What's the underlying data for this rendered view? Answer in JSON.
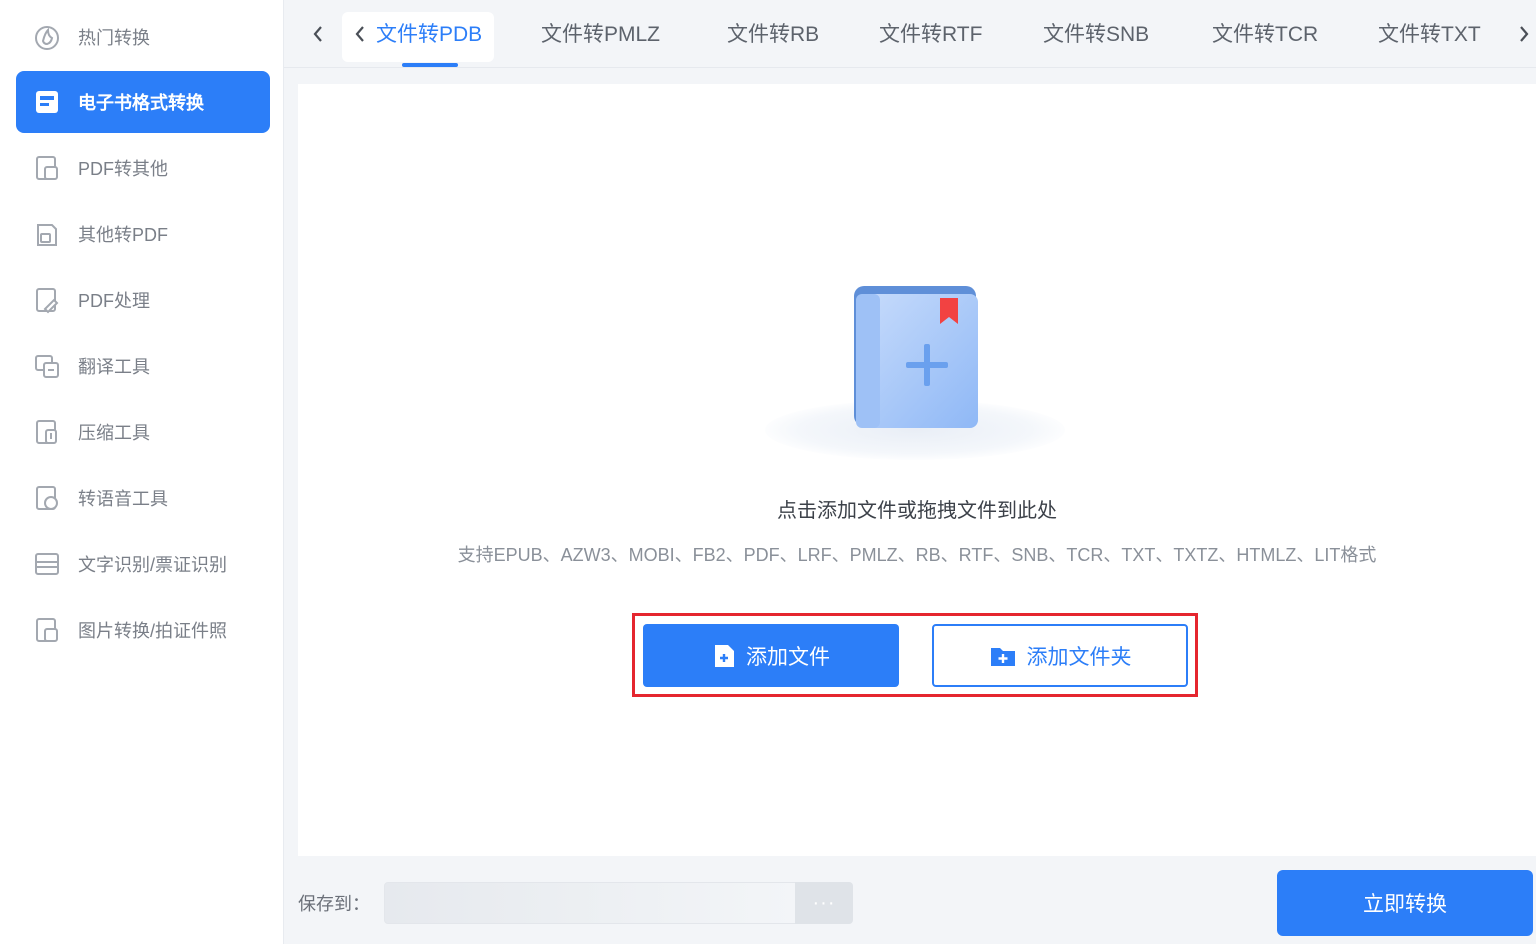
{
  "sidebar": {
    "items": [
      {
        "label": "热门转换",
        "icon": "hot-convert-icon"
      },
      {
        "label": "电子书格式转换",
        "icon": "ebook-icon",
        "active": true
      },
      {
        "label": "PDF转其他",
        "icon": "pdf-to-other-icon"
      },
      {
        "label": "其他转PDF",
        "icon": "other-to-pdf-icon"
      },
      {
        "label": "PDF处理",
        "icon": "pdf-process-icon"
      },
      {
        "label": "翻译工具",
        "icon": "translate-icon"
      },
      {
        "label": "压缩工具",
        "icon": "compress-icon"
      },
      {
        "label": "转语音工具",
        "icon": "speech-icon"
      },
      {
        "label": "文字识别/票证识别",
        "icon": "ocr-icon"
      },
      {
        "label": "图片转换/拍证件照",
        "icon": "image-icon"
      }
    ]
  },
  "tabs": [
    {
      "label": "文件转PDB",
      "active": true
    },
    {
      "label": "文件转PMLZ"
    },
    {
      "label": "文件转RB"
    },
    {
      "label": "文件转RTF"
    },
    {
      "label": "文件转SNB"
    },
    {
      "label": "文件转TCR"
    },
    {
      "label": "文件转TXT"
    }
  ],
  "dropzone": {
    "hint": "点击添加文件或拖拽文件到此处",
    "supported": "支持EPUB、AZW3、MOBI、FB2、PDF、LRF、PMLZ、RB、RTF、SNB、TCR、TXT、TXTZ、HTMLZ、LIT格式",
    "add_file_label": "添加文件",
    "add_folder_label": "添加文件夹"
  },
  "footer": {
    "save_label": "保存到：",
    "browse_label": "···",
    "convert_label": "立即转换"
  },
  "colors": {
    "accent": "#2c7ef8",
    "highlight_frame": "#e5262f"
  }
}
